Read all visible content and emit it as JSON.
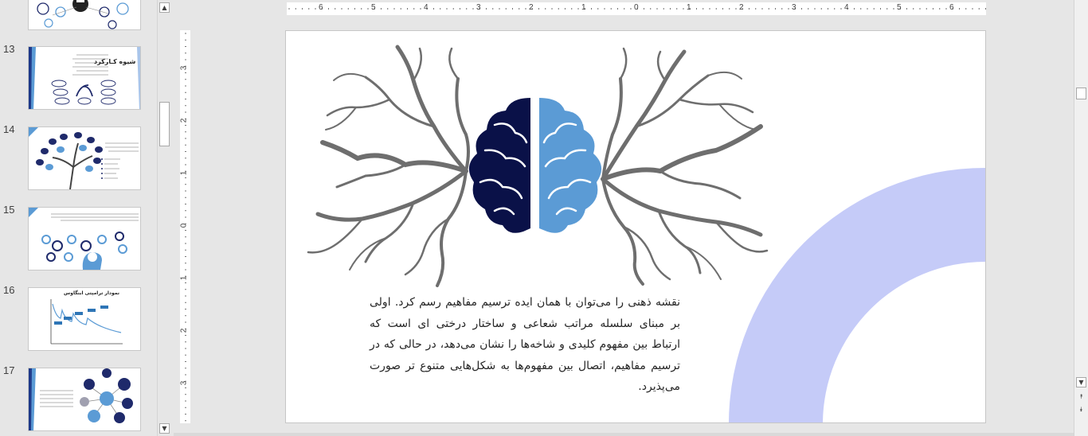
{
  "thumbnails": [
    {
      "number": "",
      "kind": "icons"
    },
    {
      "number": "13",
      "kind": "text-diagram",
      "title": "شیوه کـارکرد"
    },
    {
      "number": "14",
      "kind": "tree"
    },
    {
      "number": "15",
      "kind": "gears"
    },
    {
      "number": "16",
      "kind": "chart",
      "title": "نمودار ترامپتی ابنگاوس"
    },
    {
      "number": "17",
      "kind": "network"
    }
  ],
  "ruler": {
    "horizontal": [
      "6",
      "5",
      "4",
      "3",
      "2",
      "1",
      "0",
      "1",
      "2",
      "3",
      "4",
      "5",
      "6"
    ],
    "vertical": [
      "3",
      "2",
      "1",
      "0",
      "1",
      "2",
      "3"
    ]
  },
  "slide": {
    "body_text": "نقشه ذهنی را می‌توان با همان ایده ترسیم مفاهیم رسم کرد. اولی بر مبنای سلسله مراتب شعاعی و ساختار درختی ای است که ارتباط بین مفهوم کلیدی و شاخه‌ها را نشان می‌دهد، در حالی که در ترسیم مفاهیم، اتصال بین مفهوم‌ها به شکل‌هایی متنوع تر صورت می‌پذیرد.",
    "colors": {
      "brain_left": "#0a1148",
      "brain_right": "#5b9bd5",
      "branches": "#6e6e6e",
      "arc": "#c5cbf8"
    }
  }
}
